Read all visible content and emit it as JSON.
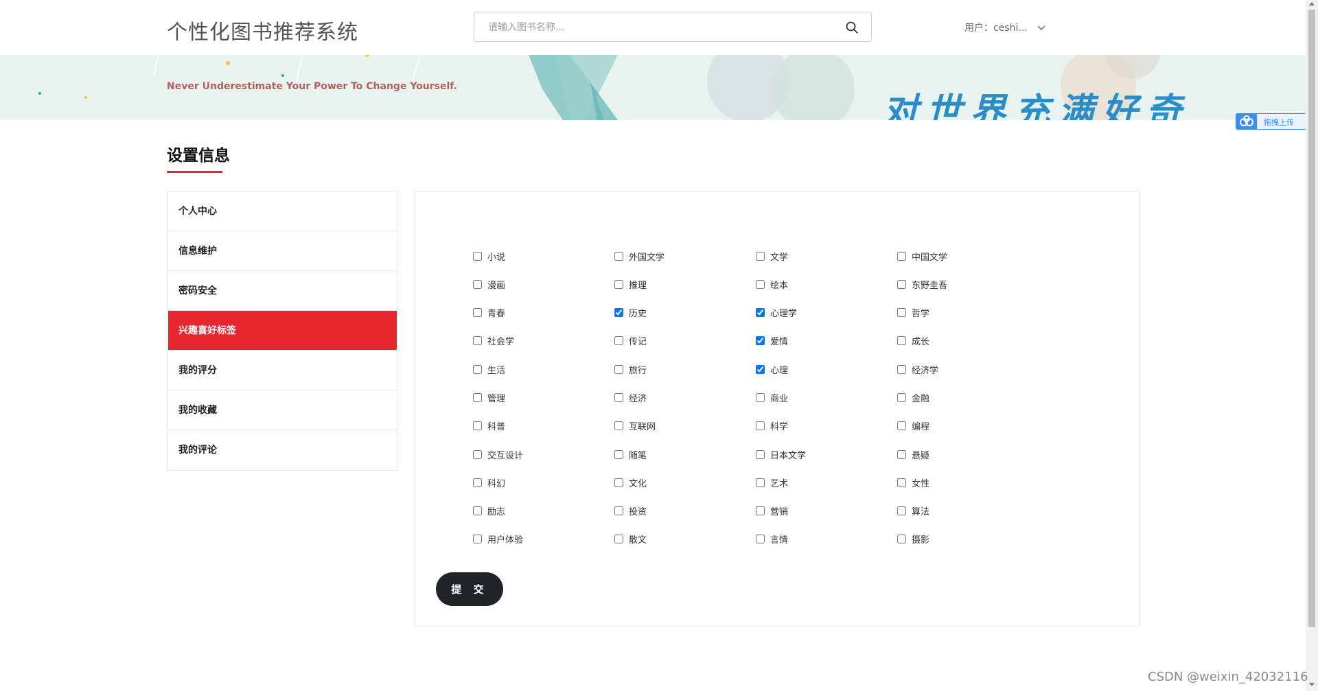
{
  "header": {
    "site_title": "个性化图书推荐系统",
    "search_placeholder": "请输入图书名称...",
    "user_label": "用户：ceshi..."
  },
  "banner": {
    "tagline": "Never Underestimate Your Power To Change Yourself.",
    "slogan": "对世界充满好奇"
  },
  "upload_chip": {
    "label": "拖拽上传"
  },
  "section": {
    "title": "设置信息"
  },
  "sidebar": {
    "items": [
      {
        "label": "个人中心",
        "active": false
      },
      {
        "label": "信息维护",
        "active": false
      },
      {
        "label": "密码安全",
        "active": false
      },
      {
        "label": "兴趣喜好标签",
        "active": true
      },
      {
        "label": "我的评分",
        "active": false
      },
      {
        "label": "我的收藏",
        "active": false
      },
      {
        "label": "我的评论",
        "active": false
      }
    ]
  },
  "tags": [
    {
      "label": "小说",
      "checked": false
    },
    {
      "label": "外国文学",
      "checked": false
    },
    {
      "label": "文学",
      "checked": false
    },
    {
      "label": "中国文学",
      "checked": false
    },
    {
      "label": "漫画",
      "checked": false
    },
    {
      "label": "推理",
      "checked": false
    },
    {
      "label": "绘本",
      "checked": false
    },
    {
      "label": "东野圭吾",
      "checked": false
    },
    {
      "label": "青春",
      "checked": false
    },
    {
      "label": "历史",
      "checked": true
    },
    {
      "label": "心理学",
      "checked": true
    },
    {
      "label": "哲学",
      "checked": false
    },
    {
      "label": "社会学",
      "checked": false
    },
    {
      "label": "传记",
      "checked": false
    },
    {
      "label": "爱情",
      "checked": true
    },
    {
      "label": "成长",
      "checked": false
    },
    {
      "label": "生活",
      "checked": false
    },
    {
      "label": "旅行",
      "checked": false
    },
    {
      "label": "心理",
      "checked": true
    },
    {
      "label": "经济学",
      "checked": false
    },
    {
      "label": "管理",
      "checked": false
    },
    {
      "label": "经济",
      "checked": false
    },
    {
      "label": "商业",
      "checked": false
    },
    {
      "label": "金融",
      "checked": false
    },
    {
      "label": "科普",
      "checked": false
    },
    {
      "label": "互联网",
      "checked": false
    },
    {
      "label": "科学",
      "checked": false
    },
    {
      "label": "编程",
      "checked": false
    },
    {
      "label": "交互设计",
      "checked": false
    },
    {
      "label": "随笔",
      "checked": false
    },
    {
      "label": "日本文学",
      "checked": false
    },
    {
      "label": "悬疑",
      "checked": false
    },
    {
      "label": "科幻",
      "checked": false
    },
    {
      "label": "文化",
      "checked": false
    },
    {
      "label": "艺术",
      "checked": false
    },
    {
      "label": "女性",
      "checked": false
    },
    {
      "label": "励志",
      "checked": false
    },
    {
      "label": "投资",
      "checked": false
    },
    {
      "label": "营销",
      "checked": false
    },
    {
      "label": "算法",
      "checked": false
    },
    {
      "label": "用户体验",
      "checked": false
    },
    {
      "label": "散文",
      "checked": false
    },
    {
      "label": "言情",
      "checked": false
    },
    {
      "label": "摄影",
      "checked": false
    }
  ],
  "submit_label": "提 交",
  "watermark": "CSDN @weixin_42032116",
  "colors": {
    "accent_red": "#e8262d",
    "button_dark": "#1f2429",
    "banner_bg": "#e8f2ee",
    "slogan_blue": "#2a8dc8",
    "tagline_brown": "#b0615c"
  },
  "icons": {
    "search": "search-icon",
    "user_dropdown": "chevron-down-icon",
    "upload": "cloud-icon"
  }
}
